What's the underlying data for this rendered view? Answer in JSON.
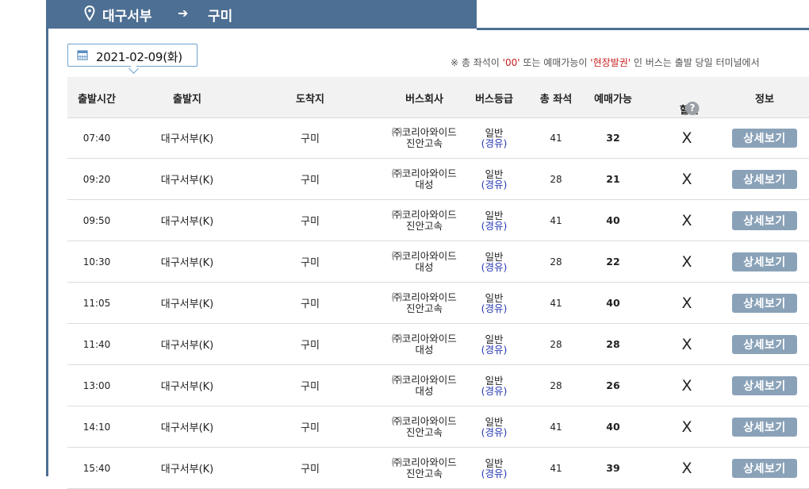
{
  "route": {
    "from": "대구서부",
    "to": "구미"
  },
  "date": {
    "value": "2021-02-09",
    "weekday": "(화)"
  },
  "notice": {
    "prefix": "※ 총 좌석이 ",
    "zero": "'00'",
    "middle": " 또는 예매가능이 ",
    "onsite": "'현장발권'",
    "suffix": " 인 버스는 출발 당일 터미널에서"
  },
  "columns": {
    "time": "출발시간",
    "departure": "출발지",
    "arrival": "도착지",
    "company": "버스회사",
    "grade": "버스등급",
    "total_seats": "총 좌석",
    "available": "예매가능",
    "discount": "할인",
    "info": "정보"
  },
  "help_icon": "?",
  "rows": [
    {
      "time": "07:40",
      "departure": "대구서부(K)",
      "arrival": "구미",
      "company_line1": "㈜코리아와이드",
      "company_line2": "진안고속",
      "grade": "일반",
      "route_type": "(경유)",
      "seats": "41",
      "available": "32",
      "discount": "X",
      "button": "상세보기"
    },
    {
      "time": "09:20",
      "departure": "대구서부(K)",
      "arrival": "구미",
      "company_line1": "㈜코리아와이드",
      "company_line2": "대성",
      "grade": "일반",
      "route_type": "(경유)",
      "seats": "28",
      "available": "21",
      "discount": "X",
      "button": "상세보기"
    },
    {
      "time": "09:50",
      "departure": "대구서부(K)",
      "arrival": "구미",
      "company_line1": "㈜코리아와이드",
      "company_line2": "진안고속",
      "grade": "일반",
      "route_type": "(경유)",
      "seats": "41",
      "available": "40",
      "discount": "X",
      "button": "상세보기"
    },
    {
      "time": "10:30",
      "departure": "대구서부(K)",
      "arrival": "구미",
      "company_line1": "㈜코리아와이드",
      "company_line2": "대성",
      "grade": "일반",
      "route_type": "(경유)",
      "seats": "28",
      "available": "22",
      "discount": "X",
      "button": "상세보기"
    },
    {
      "time": "11:05",
      "departure": "대구서부(K)",
      "arrival": "구미",
      "company_line1": "㈜코리아와이드",
      "company_line2": "진안고속",
      "grade": "일반",
      "route_type": "(경유)",
      "seats": "41",
      "available": "40",
      "discount": "X",
      "button": "상세보기"
    },
    {
      "time": "11:40",
      "departure": "대구서부(K)",
      "arrival": "구미",
      "company_line1": "㈜코리아와이드",
      "company_line2": "대성",
      "grade": "일반",
      "route_type": "(경유)",
      "seats": "28",
      "available": "28",
      "discount": "X",
      "button": "상세보기"
    },
    {
      "time": "13:00",
      "departure": "대구서부(K)",
      "arrival": "구미",
      "company_line1": "㈜코리아와이드",
      "company_line2": "대성",
      "grade": "일반",
      "route_type": "(경유)",
      "seats": "28",
      "available": "26",
      "discount": "X",
      "button": "상세보기"
    },
    {
      "time": "14:10",
      "departure": "대구서부(K)",
      "arrival": "구미",
      "company_line1": "㈜코리아와이드",
      "company_line2": "진안고속",
      "grade": "일반",
      "route_type": "(경유)",
      "seats": "41",
      "available": "40",
      "discount": "X",
      "button": "상세보기"
    },
    {
      "time": "15:40",
      "departure": "대구서부(K)",
      "arrival": "구미",
      "company_line1": "㈜코리아와이드",
      "company_line2": "진안고속",
      "grade": "일반",
      "route_type": "(경유)",
      "seats": "41",
      "available": "39",
      "discount": "X",
      "button": "상세보기"
    }
  ]
}
